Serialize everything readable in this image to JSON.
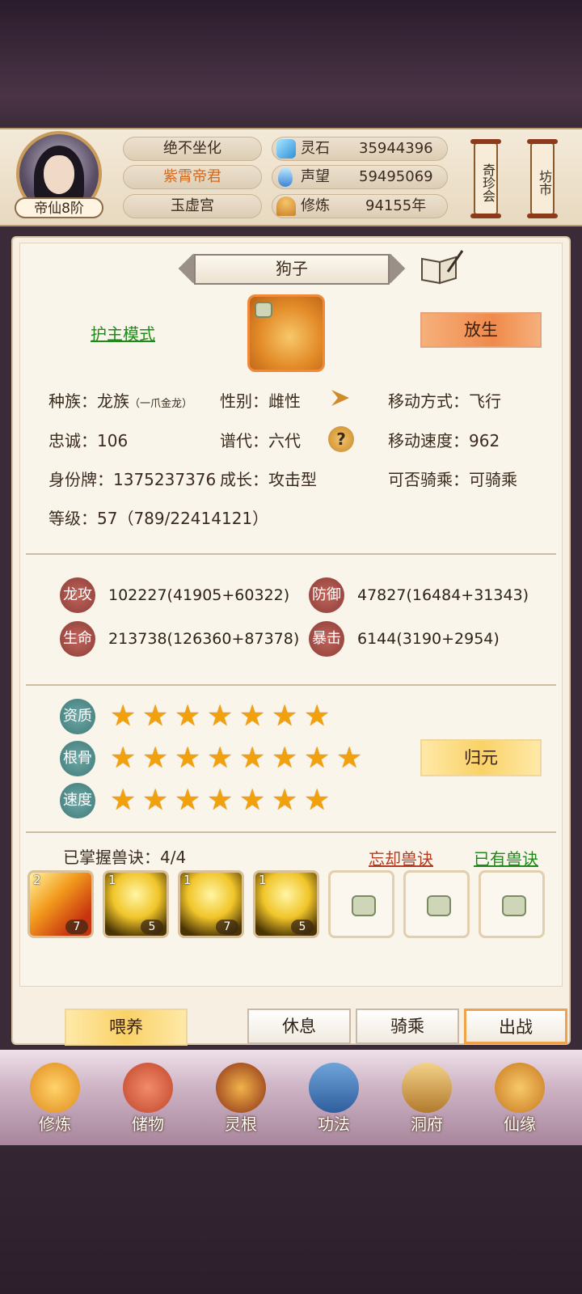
{
  "player": {
    "rank": "帝仙8阶",
    "name": "绝不坐化",
    "title": "紫霄帝君",
    "sect": "玉虚宫"
  },
  "currencies": [
    {
      "icon": "spirit-stone-icon",
      "label": "灵石",
      "value": "35944396"
    },
    {
      "icon": "prestige-icon",
      "label": "声望",
      "value": "59495069"
    },
    {
      "icon": "meditation-icon",
      "label": "修炼",
      "value": "94155年"
    }
  ],
  "side_buttons": {
    "treasure": "奇珍会",
    "market": "坊市"
  },
  "pet": {
    "name": "狗子",
    "guard_mode": "护主模式",
    "release": "放生",
    "race_label": "种族：",
    "race": "龙族",
    "race_sub": "（一爪金龙）",
    "gender_label": "性别：",
    "gender": "雌性",
    "move_type_label": "移动方式：",
    "move_type": "飞行",
    "loyalty_label": "忠诚：",
    "loyalty": "106",
    "generation_label": "谱代：",
    "generation": "六代",
    "move_speed_label": "移动速度：",
    "move_speed": "962",
    "id_label": "身份牌：",
    "id": "1375237376",
    "growth_label": "成长：",
    "growth": "攻击型",
    "rideable_label": "可否骑乘：",
    "rideable": "可骑乘",
    "level_label": "等级：",
    "level": "57（789/22414121）"
  },
  "stats": [
    {
      "label": "龙攻",
      "value": "102227(41905+60322)"
    },
    {
      "label": "防御",
      "value": "47827(16484+31343)"
    },
    {
      "label": "生命",
      "value": "213738(126360+87378)"
    },
    {
      "label": "暴击",
      "value": "6144(3190+2954)"
    }
  ],
  "talents": [
    {
      "label": "资质",
      "stars": 7
    },
    {
      "label": "根骨",
      "stars": 8
    },
    {
      "label": "速度",
      "stars": 7
    }
  ],
  "return_button": "归元",
  "skills_header": {
    "mastered": "已掌握兽诀：4/4",
    "forget": "忘却兽诀",
    "owned": "已有兽诀"
  },
  "skills": [
    {
      "level": "2",
      "count": "7",
      "style": "fire"
    },
    {
      "level": "1",
      "count": "5",
      "style": "gold"
    },
    {
      "level": "1",
      "count": "7",
      "style": "gold"
    },
    {
      "level": "1",
      "count": "5",
      "style": "gold"
    },
    {
      "level": "",
      "count": "",
      "style": "empty"
    },
    {
      "level": "",
      "count": "",
      "style": "empty"
    },
    {
      "level": "",
      "count": "",
      "style": "empty"
    }
  ],
  "actions": {
    "feed": "喂养",
    "rest": "休息",
    "ride": "骑乘",
    "battle": "出战"
  },
  "nav": [
    {
      "icon": "cultivate-icon",
      "label": "修炼"
    },
    {
      "icon": "storage-bag-icon",
      "label": "储物"
    },
    {
      "icon": "spirit-root-icon",
      "label": "灵根"
    },
    {
      "icon": "technique-book-icon",
      "label": "功法"
    },
    {
      "icon": "cave-mansion-icon",
      "label": "洞府"
    },
    {
      "icon": "destiny-gourd-icon",
      "label": "仙缘"
    }
  ]
}
